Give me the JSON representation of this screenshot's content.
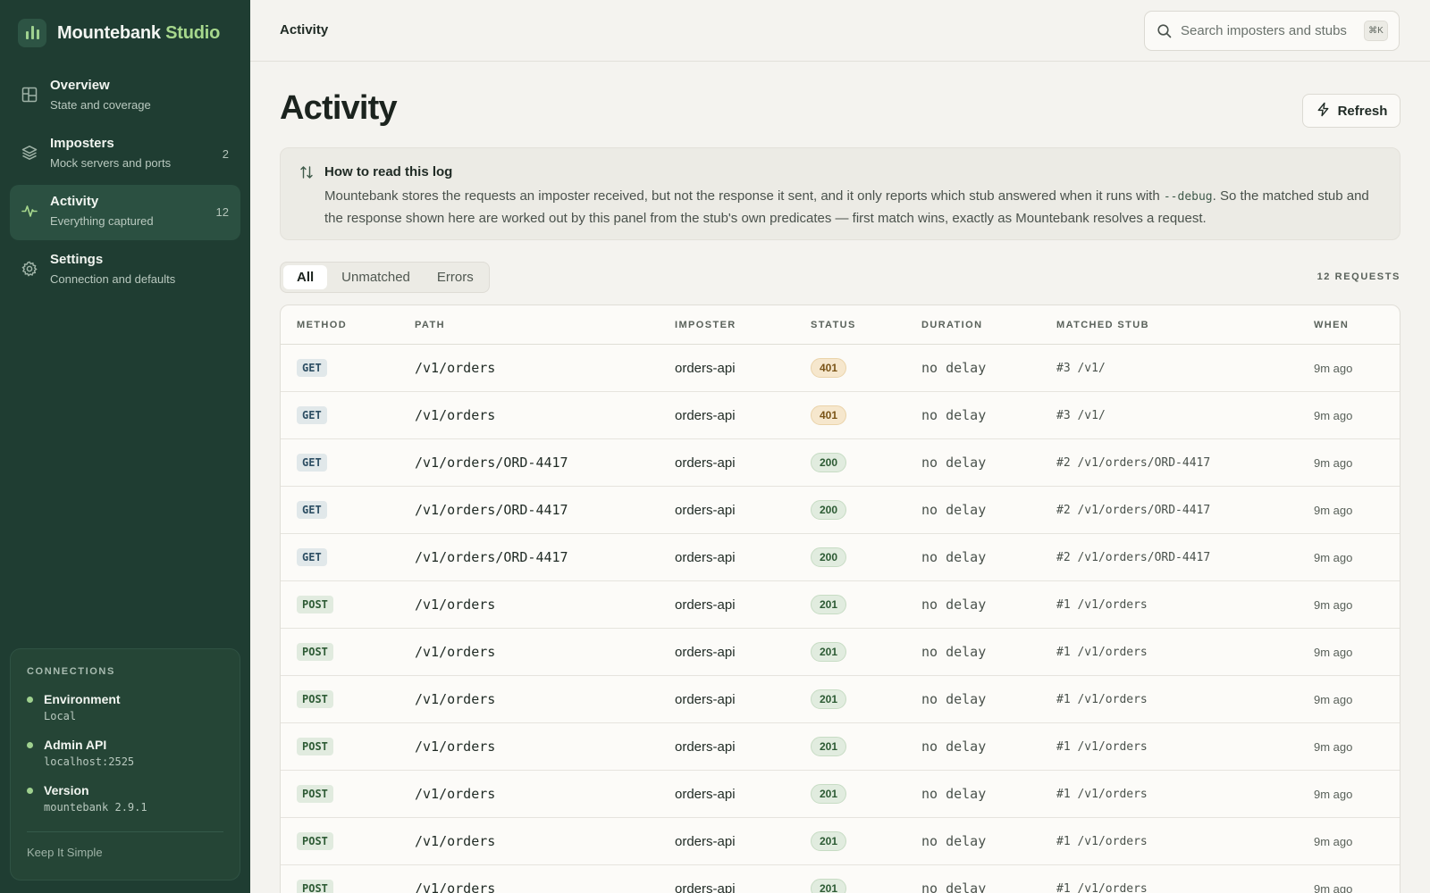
{
  "brand": {
    "name": "Mountebank",
    "accent": "Studio"
  },
  "nav": [
    {
      "title": "Overview",
      "sub": "State and coverage",
      "count": "",
      "icon": "grid-icon",
      "active": false
    },
    {
      "title": "Imposters",
      "sub": "Mock servers and ports",
      "count": "2",
      "icon": "layers-icon",
      "active": false
    },
    {
      "title": "Activity",
      "sub": "Everything captured",
      "count": "12",
      "icon": "pulse-icon",
      "active": true
    },
    {
      "title": "Settings",
      "sub": "Connection and defaults",
      "count": "",
      "icon": "gear-icon",
      "active": false
    }
  ],
  "connections": {
    "title": "CONNECTIONS",
    "items": [
      {
        "label": "Environment",
        "value": "Local"
      },
      {
        "label": "Admin API",
        "value": "localhost:2525"
      },
      {
        "label": "Version",
        "value": "mountebank 2.9.1"
      }
    ],
    "footer": "Keep It Simple"
  },
  "topbar": {
    "crumb": "Activity",
    "search_placeholder": "Search imposters and stubs",
    "shortcut": "⌘K"
  },
  "page": {
    "title": "Activity",
    "refresh_label": "Refresh"
  },
  "info": {
    "title": "How to read this log",
    "body_before": "Mountebank stores the requests an imposter received, but not the response it sent, and it only reports which stub answered when it runs with ",
    "body_code": "--debug",
    "body_after": ". So the matched stub and the response shown here are worked out by this panel from the stub's own predicates — first match wins, exactly as Mountebank resolves a request."
  },
  "tabs": [
    "All",
    "Unmatched",
    "Errors"
  ],
  "active_tab": "All",
  "request_count": "12 REQUESTS",
  "table": {
    "headers": [
      "METHOD",
      "PATH",
      "IMPOSTER",
      "STATUS",
      "DURATION",
      "MATCHED STUB",
      "WHEN"
    ],
    "rows": [
      {
        "method": "GET",
        "path": "/v1/orders",
        "imposter": "orders-api",
        "status": "401",
        "duration": "no delay",
        "stub": "#3 /v1/",
        "when": "9m ago"
      },
      {
        "method": "GET",
        "path": "/v1/orders",
        "imposter": "orders-api",
        "status": "401",
        "duration": "no delay",
        "stub": "#3 /v1/",
        "when": "9m ago"
      },
      {
        "method": "GET",
        "path": "/v1/orders/ORD-4417",
        "imposter": "orders-api",
        "status": "200",
        "duration": "no delay",
        "stub": "#2 /v1/orders/ORD-4417",
        "when": "9m ago"
      },
      {
        "method": "GET",
        "path": "/v1/orders/ORD-4417",
        "imposter": "orders-api",
        "status": "200",
        "duration": "no delay",
        "stub": "#2 /v1/orders/ORD-4417",
        "when": "9m ago"
      },
      {
        "method": "GET",
        "path": "/v1/orders/ORD-4417",
        "imposter": "orders-api",
        "status": "200",
        "duration": "no delay",
        "stub": "#2 /v1/orders/ORD-4417",
        "when": "9m ago"
      },
      {
        "method": "POST",
        "path": "/v1/orders",
        "imposter": "orders-api",
        "status": "201",
        "duration": "no delay",
        "stub": "#1 /v1/orders",
        "when": "9m ago"
      },
      {
        "method": "POST",
        "path": "/v1/orders",
        "imposter": "orders-api",
        "status": "201",
        "duration": "no delay",
        "stub": "#1 /v1/orders",
        "when": "9m ago"
      },
      {
        "method": "POST",
        "path": "/v1/orders",
        "imposter": "orders-api",
        "status": "201",
        "duration": "no delay",
        "stub": "#1 /v1/orders",
        "when": "9m ago"
      },
      {
        "method": "POST",
        "path": "/v1/orders",
        "imposter": "orders-api",
        "status": "201",
        "duration": "no delay",
        "stub": "#1 /v1/orders",
        "when": "9m ago"
      },
      {
        "method": "POST",
        "path": "/v1/orders",
        "imposter": "orders-api",
        "status": "201",
        "duration": "no delay",
        "stub": "#1 /v1/orders",
        "when": "9m ago"
      },
      {
        "method": "POST",
        "path": "/v1/orders",
        "imposter": "orders-api",
        "status": "201",
        "duration": "no delay",
        "stub": "#1 /v1/orders",
        "when": "9m ago"
      },
      {
        "method": "POST",
        "path": "/v1/orders",
        "imposter": "orders-api",
        "status": "201",
        "duration": "no delay",
        "stub": "#1 /v1/orders",
        "when": "9m ago"
      }
    ]
  },
  "colors": {
    "sidebar": "#1f3d32",
    "accent": "#a7d88d",
    "background": "#f4f3ef"
  }
}
